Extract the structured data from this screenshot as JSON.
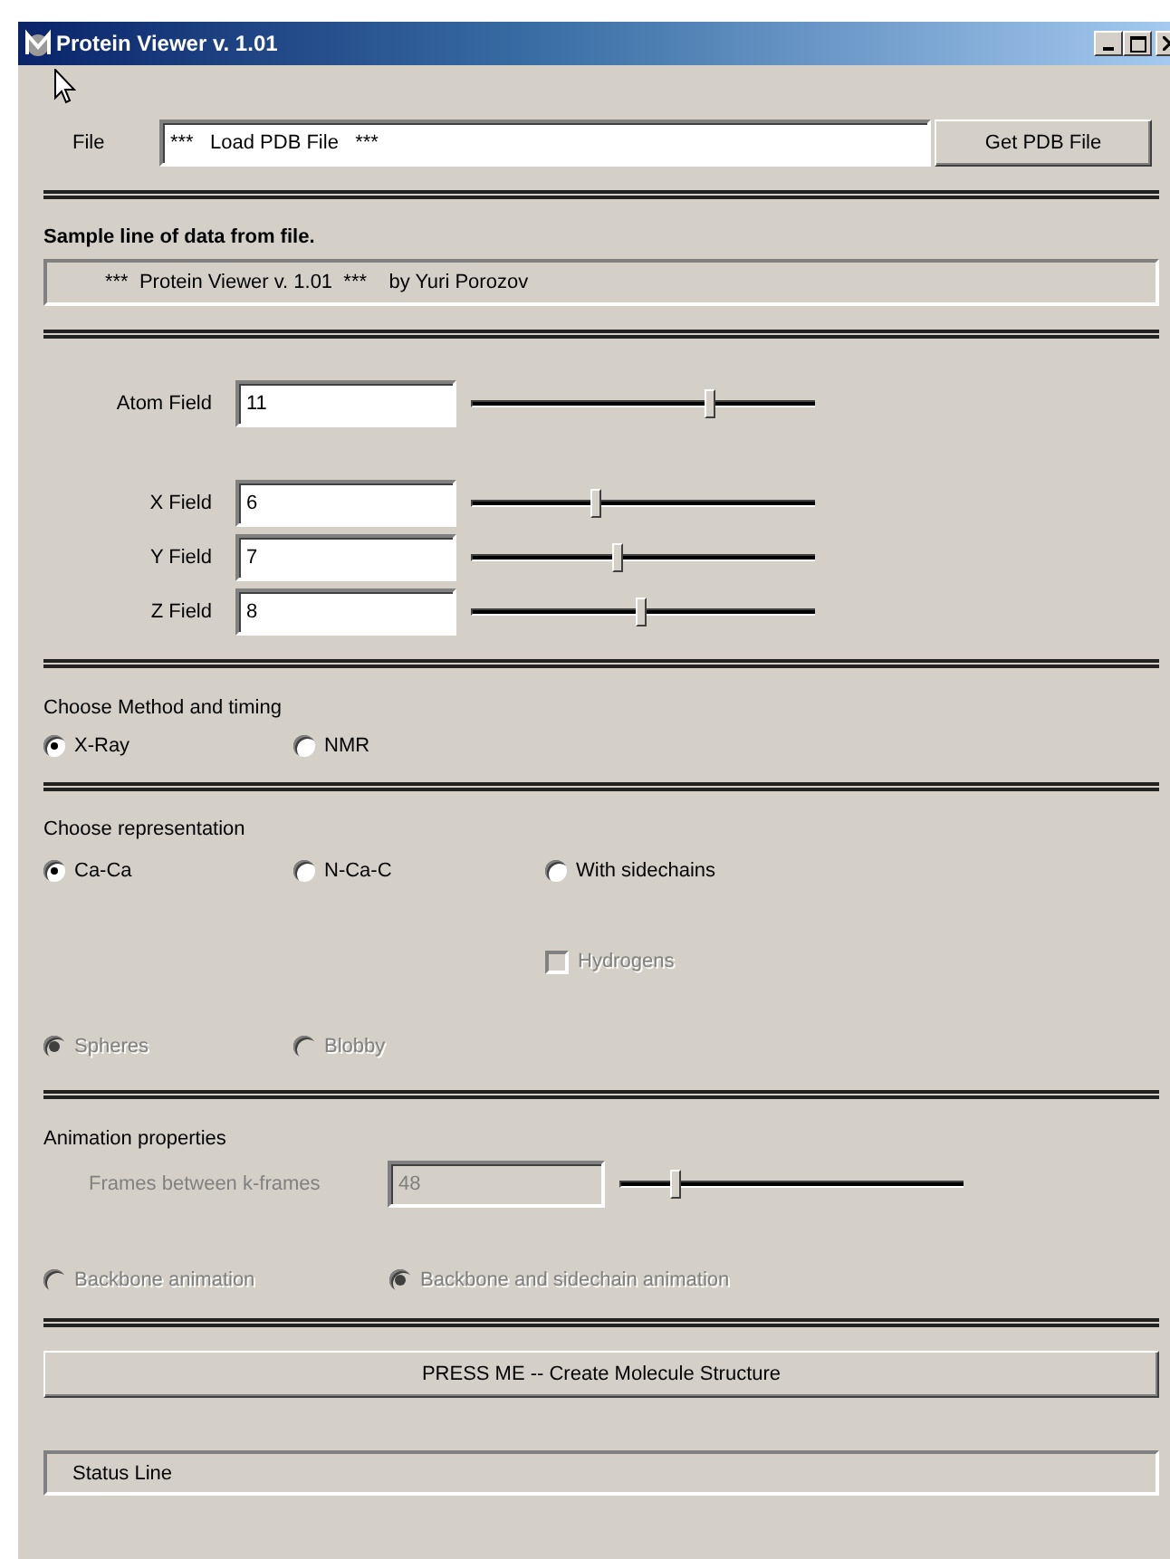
{
  "window": {
    "title": "Protein Viewer  v. 1.01"
  },
  "file": {
    "label": "File",
    "value": "***   Load PDB File   ***",
    "button": "Get PDB File"
  },
  "sample": {
    "heading": "Sample line of data from file.",
    "line": "***  Protein Viewer v. 1.01  ***    by Yuri Porozov"
  },
  "fields": [
    {
      "label": "Atom Field",
      "value": "11",
      "level": 0.7
    },
    {
      "label": "X Field",
      "value": "6",
      "level": 0.37
    },
    {
      "label": "Y Field",
      "value": "7",
      "level": 0.43
    },
    {
      "label": "Z Field",
      "value": "8",
      "level": 0.5
    }
  ],
  "method": {
    "heading": "Choose Method and timing",
    "options": [
      {
        "label": "X-Ray",
        "selected": true,
        "disabled": false
      },
      {
        "label": "NMR",
        "selected": false,
        "disabled": false
      }
    ]
  },
  "representation": {
    "heading": "Choose representation",
    "rows": [
      [
        {
          "kind": "radio",
          "label": "Ca-Ca",
          "selected": true,
          "disabled": false
        },
        {
          "kind": "radio",
          "label": "N-Ca-C",
          "selected": false,
          "disabled": false
        },
        {
          "kind": "radio",
          "label": "With sidechains",
          "selected": false,
          "disabled": false
        }
      ],
      [
        "",
        "",
        {
          "kind": "checkbox",
          "label": "Hydrogens",
          "checked": false,
          "disabled": true
        }
      ],
      [
        {
          "kind": "radio",
          "label": "Spheres",
          "selected": true,
          "disabled": true
        },
        {
          "kind": "radio",
          "label": "Blobby",
          "selected": false,
          "disabled": true
        }
      ]
    ]
  },
  "animation": {
    "heading": "Animation properties",
    "frames": {
      "label": "Frames between k-frames",
      "value": "48",
      "disabled": true,
      "level": 0.17
    },
    "options": [
      {
        "label": "Backbone animation",
        "selected": false,
        "disabled": true
      },
      {
        "label": "Backbone and sidechain animation",
        "selected": true,
        "disabled": true
      }
    ]
  },
  "create_button": "PRESS ME -- Create Molecule Structure",
  "status": "Status Line"
}
